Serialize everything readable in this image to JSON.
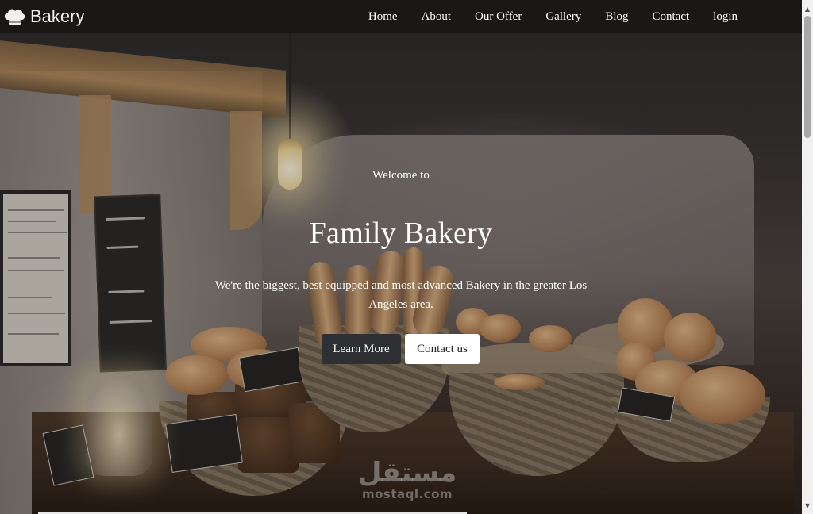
{
  "navbar": {
    "brand": {
      "name": "Bakery",
      "icon": "chef-hat-icon"
    },
    "links": [
      {
        "label": "Home"
      },
      {
        "label": "About"
      },
      {
        "label": "Our Offer"
      },
      {
        "label": "Gallery"
      },
      {
        "label": "Blog"
      },
      {
        "label": "Contact"
      },
      {
        "label": "login"
      }
    ]
  },
  "hero": {
    "welcome": "Welcome to",
    "title": "Family Bakery",
    "description": "We're the biggest, best equipped and most advanced Bakery in the greater Los Angeles area.",
    "buttons": {
      "primary": "Learn More",
      "secondary": "Contact us"
    }
  },
  "watermark": {
    "arabic": "مستقل",
    "latin": "mostaql.com"
  },
  "scrollbar": {
    "up_icon": "scroll-up-arrow-icon",
    "down_icon": "scroll-down-arrow-icon"
  },
  "colors": {
    "navbar_bg": "#181615",
    "primary_button_bg": "#2f3033",
    "secondary_button_bg": "#ffffff",
    "text": "#ffffff"
  }
}
